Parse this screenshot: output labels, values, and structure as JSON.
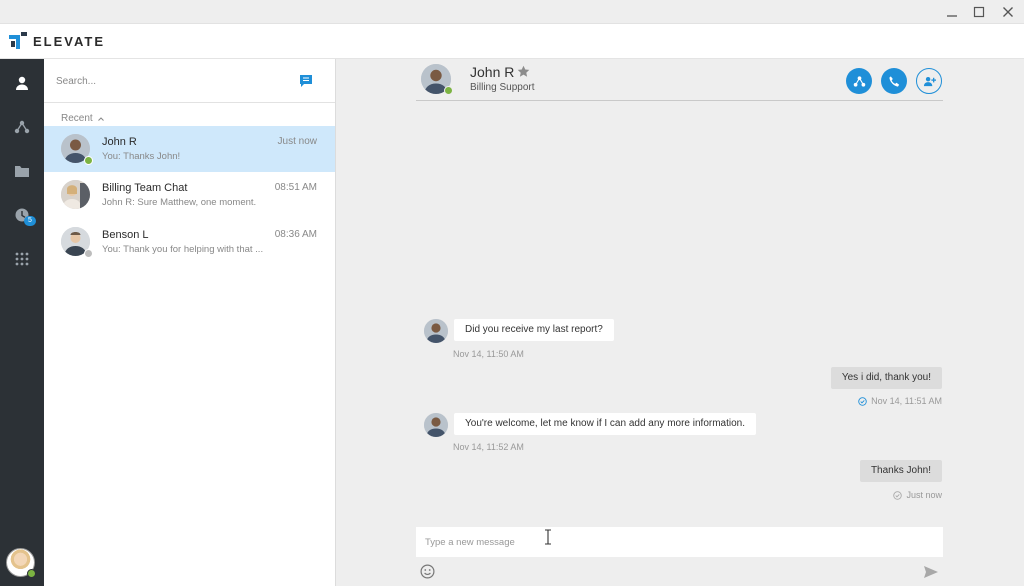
{
  "app": {
    "brand": "ELEVATE",
    "colors": {
      "accent": "#1f8fd8",
      "rail": "#2c3136",
      "active_row": "#cfe8fb",
      "online": "#7cb342",
      "offline": "#bdbdbd"
    }
  },
  "window_controls": [
    {
      "name": "minimize-icon"
    },
    {
      "name": "maximize-icon"
    },
    {
      "name": "close-icon"
    }
  ],
  "rail": {
    "items": [
      {
        "name": "contacts-icon"
      },
      {
        "name": "network-icon"
      },
      {
        "name": "folder-icon"
      },
      {
        "name": "clock-icon",
        "badge": "5"
      },
      {
        "name": "apps-grid-icon"
      }
    ]
  },
  "search": {
    "placeholder": "Search..."
  },
  "list": {
    "section_label": "Recent",
    "conversations": [
      {
        "name": "John R",
        "time": "Just now",
        "preview": "You: Thanks John!",
        "status": "online"
      },
      {
        "name": "Billing Team Chat",
        "time": "08:51 AM",
        "preview": "John R: Sure Matthew, one moment.",
        "status": "none"
      },
      {
        "name": "Benson L",
        "time": "08:36 AM",
        "preview": "You: Thank you for helping with that ...",
        "status": "offline"
      }
    ]
  },
  "chat": {
    "contact_name": "John R",
    "contact_role": "Billing Support",
    "messages": [
      {
        "direction": "in",
        "text": "Did you receive my last report?",
        "time": "Nov 14, 11:50 AM"
      },
      {
        "direction": "out",
        "text": "Yes i did, thank you!",
        "time": "Nov 14, 11:51 AM"
      },
      {
        "direction": "in",
        "text": "You're welcome, let me know if I can add any more information.",
        "time": "Nov 14, 11:52 AM"
      },
      {
        "direction": "out",
        "text": "Thanks John!",
        "time": "Just now"
      }
    ],
    "composer_placeholder": "Type a new message"
  }
}
